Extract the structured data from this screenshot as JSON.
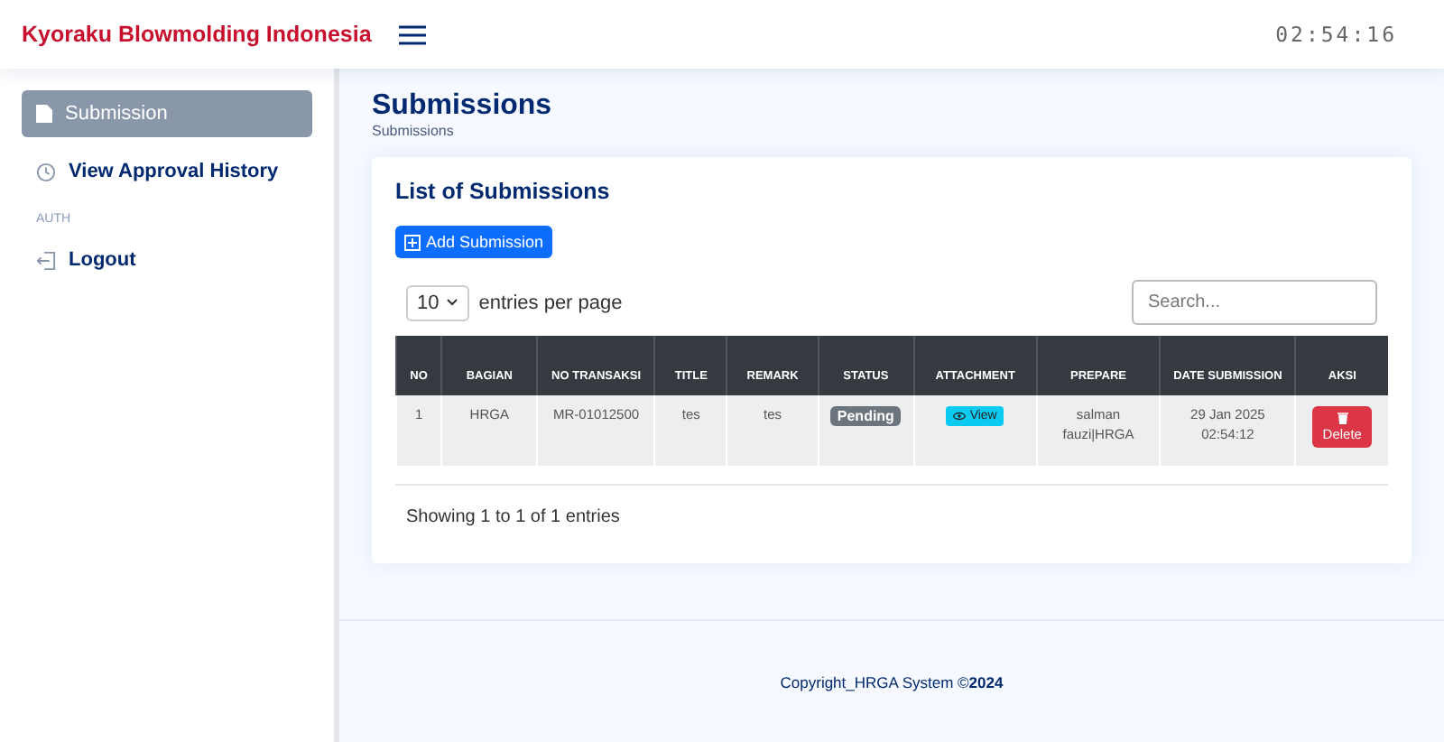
{
  "header": {
    "brand": "Kyoraku Blowmolding Indonesia",
    "clock": "02:54:16"
  },
  "sidebar": {
    "items": [
      {
        "label": "Submission",
        "selected": true
      },
      {
        "label": "View Approval History",
        "selected": false
      }
    ],
    "section": "AUTH",
    "auth_items": [
      {
        "label": "Logout",
        "selected": false
      }
    ]
  },
  "page": {
    "title": "Submissions",
    "breadcrumb": "Submissions"
  },
  "card": {
    "title": "List of Submissions",
    "add_button": "Add Submission",
    "page_size": "10",
    "page_size_label": "entries per page",
    "search": {
      "placeholder": "Search..."
    },
    "table": {
      "columns": [
        "NO",
        "BAGIAN",
        "NO TRANSAKSI",
        "TITLE",
        "REMARK",
        "STATUS",
        "ATTACHMENT",
        "PREPARE",
        "DATE SUBMISSION",
        "AKSI"
      ],
      "rows": [
        {
          "no": "1",
          "bagian": "HRGA",
          "no_transaksi": "MR-01012500",
          "title": "tes",
          "remark": "tes",
          "status": "Pending",
          "attachment": "View",
          "prepare": "salman fauzi|HRGA",
          "date": "29 Jan 2025 02:54:12",
          "action": "Delete"
        }
      ]
    },
    "info": "Showing 1 to 1 of 1 entries"
  },
  "footer": "Copyright_HRGA System ©**2024**"
}
